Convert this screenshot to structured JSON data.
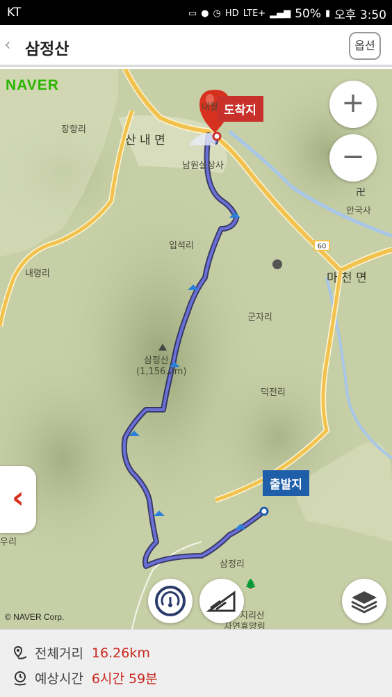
{
  "status_bar": {
    "carrier": "KT",
    "battery": "50%",
    "time": "오후 3:50",
    "network": "LTE+"
  },
  "header": {
    "title": "삼정산",
    "options_label": "옵션"
  },
  "map": {
    "provider_logo": "NAVER",
    "copyright": "© NAVER Corp.",
    "zoom_in": "+",
    "zoom_out": "−",
    "arrival_label": "도착지",
    "departure_label": "출발지",
    "road_number": "60",
    "labels": {
      "janghang": "장항리",
      "sannae": "산 내 면",
      "naewol": "내월",
      "namwon_silsangsa": "남원실상사",
      "ipseok": "입석리",
      "naeryeong": "내령리",
      "gunja": "군자리",
      "samjeongsan_peak": "삼정산",
      "elevation": "(1,156.2m)",
      "deokjeon": "덕전리",
      "macheon": "마 천 면",
      "anguksa": "안국사",
      "samjeong_ri": "삼정리",
      "jirisan": "지리산",
      "recreation": "자연휴양림",
      "uri": "우리"
    }
  },
  "route_info": {
    "distance_label": "전체거리",
    "distance_value": "16.26km",
    "time_label": "예상시간",
    "time_value": "6시간 59분"
  },
  "colors": {
    "route": "#4a4fb5",
    "road": "#f2c24e",
    "arrival": "#c8302c",
    "departure": "#1f5ea8",
    "value_text": "#c8281e"
  }
}
